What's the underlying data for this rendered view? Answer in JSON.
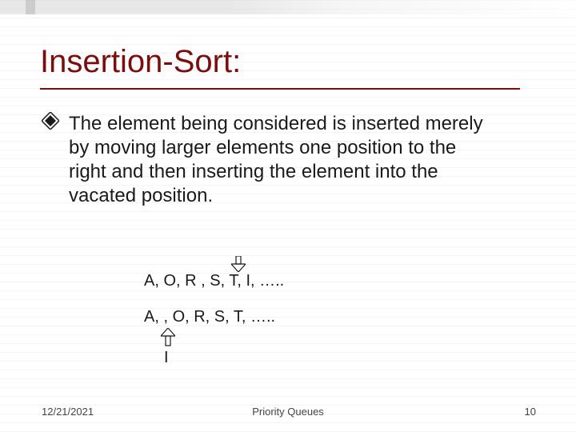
{
  "title": "Insertion-Sort:",
  "bullet_text": "The element being considered is inserted merely by moving larger elements one position to the right and then inserting the element into the vacated position.",
  "sequence_before": "A, O, R , S, T, I, …..",
  "sequence_after": "A,   , O, R, S, T, …..",
  "moving_element": "I",
  "footer": {
    "date": "12/21/2021",
    "center": "Priority Queues",
    "page": "10"
  },
  "colors": {
    "title": "#7a0d0d",
    "text": "#1a1a1a"
  }
}
